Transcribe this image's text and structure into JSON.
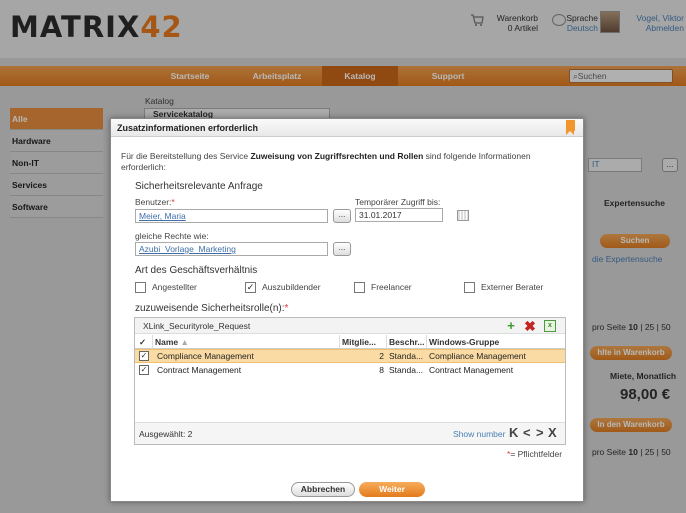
{
  "header": {
    "logo_main": "MATRIX",
    "logo_accent": "42",
    "cart_title": "Warenkorb",
    "cart_count": "0 Artikel",
    "lang_title": "Sprache",
    "lang_value": "Deutsch",
    "user_name": "Vogel, Viktor",
    "logout": "Abmelden"
  },
  "nav": {
    "items": [
      "Startseite",
      "Arbeitsplatz",
      "Katalog",
      "Support"
    ],
    "search_placeholder": "Suchen"
  },
  "sidebar": {
    "items": [
      "Alle",
      "Hardware",
      "Non-IT",
      "Services",
      "Software"
    ]
  },
  "background": {
    "breadcrumb": "Katalog",
    "tab": "Servicekatalog",
    "non_it": "IT",
    "expert_search": "Expertensuche",
    "search_btn": "Suchen",
    "expert_link": "die Expertensuche",
    "per_page_prefix": "pro Seite",
    "per_page_sel": "10",
    "per_page_opts": "| 25 | 50",
    "add_to_cart1": "hlte in Warenkorb",
    "price_label": "Miete, Monatlich",
    "price": "98,00 €",
    "add_to_cart2": "In den Warenkorb"
  },
  "modal": {
    "title": "Zusatzinformationen erforderlich",
    "intro_pre": "Für die Bereitstellung des Service ",
    "intro_bold": "Zuweisung von Zugriffsrechten und Rollen",
    "intro_post": " sind folgende Informationen erforderlich:",
    "section1": "Sicherheitsrelevante Anfrage",
    "user_label": "Benutzer:",
    "required_mark": "*",
    "user_value": "Meier, Maria",
    "temp_label": "Temporärer Zugriff bis:",
    "temp_value": "31.01.2017",
    "same_rights_label": "gleiche Rechte wie:",
    "same_rights_value": "Azubi_Vorlage_Marketing",
    "dots": "...",
    "section2": "Art des Geschäftsverhältnis",
    "employment": [
      {
        "label": "Angestellter",
        "checked": ""
      },
      {
        "label": "Auszubildender",
        "checked": "✓"
      },
      {
        "label": "Freelancer",
        "checked": ""
      },
      {
        "label": "Externer Berater",
        "checked": ""
      }
    ],
    "section3": "zuzuweisende Sicherheitsrolle(n):",
    "grid": {
      "title": "XLink_Securityrole_Request",
      "header_check": "✓",
      "columns": [
        "Name",
        "Mitglie...",
        "Beschr...",
        "Windows-Gruppe"
      ],
      "rows": [
        {
          "check": "✓",
          "name": "Compliance Management",
          "members": "2",
          "desc": "Standa...",
          "group": "Compliance Management"
        },
        {
          "check": "✓",
          "name": "Contract Management",
          "members": "8",
          "desc": "Standa...",
          "group": "Contract Management"
        }
      ],
      "selected": "Ausgewählt: 2",
      "show_number": "Show number",
      "pager": [
        "K",
        "<",
        ">",
        "X"
      ]
    },
    "required_note": "= Pflichtfelder",
    "cancel": "Abbrechen",
    "next": "Weiter"
  }
}
